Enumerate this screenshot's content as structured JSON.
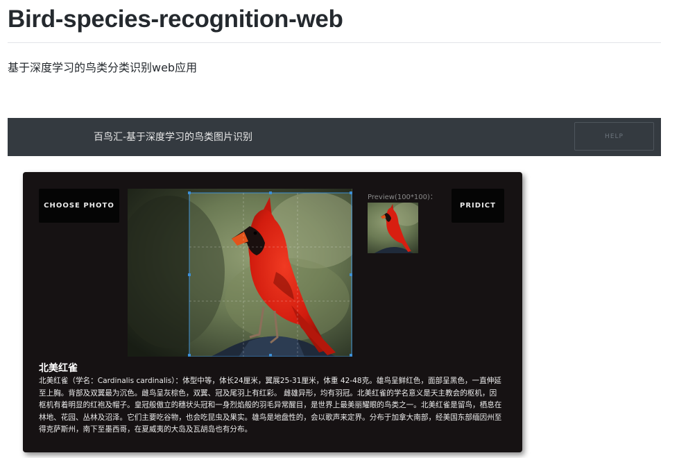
{
  "readme": {
    "title": "Bird-species-recognition-web",
    "description": "基于深度学习的鸟类分类识别web应用"
  },
  "app": {
    "header_title": "百鸟汇-基于深度学习的鸟类图片识别",
    "help_label": "HELP",
    "choose_photo_label": "CHOOSE PHOTO",
    "predict_label": "PRIDICT",
    "preview_label": "Preview(100*100)：",
    "result": {
      "species_name": "北美红雀",
      "description": "北美红雀（学名：Cardinalis cardinalis）：体型中等，体长24厘米，翼展25-31厘米，体重 42-48克。雄鸟呈鲜红色，面部呈黑色，一直伸延至上胸。背部及双翼最为沉色。雌鸟呈灰棕色，双翼、冠及尾羽上有红彩。 雌雄异形，均有羽冠。北美红雀的学名意义是天主教会的枢机，因枢机有着明显的红袍及帽子。皇冠般傲立的穗状头冠和一身烈焰般的羽毛异常醒目，是世界上最美丽耀眼的鸟类之一。北美红雀是留鸟，栖息在林地、花园、丛林及沼泽。它们主要吃谷物，也会吃昆虫及果实。雄鸟是地盘性的，会以歌声来定界。分布于加拿大南部，经美国东部缅因州至得克萨斯州，南下至墨西哥，在夏威夷的大岛及瓦胡岛也有分布。"
    }
  },
  "colors": {
    "app_bar": "#343a40",
    "card": "#161213",
    "bird_red": "#d81e10",
    "crop_outline": "#3d8fd6"
  },
  "icons": [
    "bird-photo",
    "crop-selection-frame",
    "crop-handle"
  ]
}
